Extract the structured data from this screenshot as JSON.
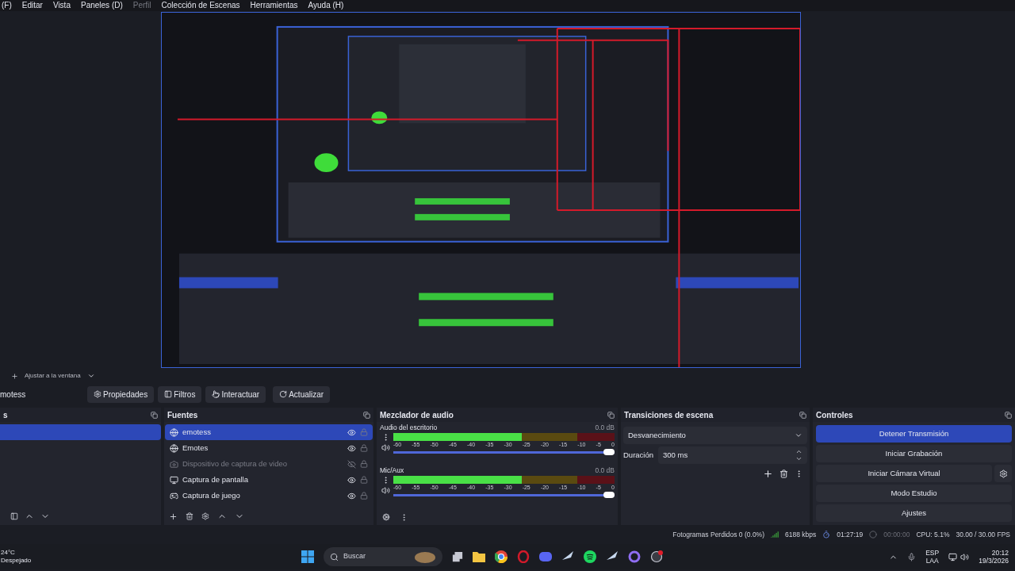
{
  "menu_bar": [
    {
      "label": "(F)",
      "disabled": false
    },
    {
      "label": "Editar",
      "disabled": false
    },
    {
      "label": "Vista",
      "disabled": false
    },
    {
      "label": "Paneles (D)",
      "disabled": false
    },
    {
      "label": "Perfil",
      "disabled": true
    },
    {
      "label": "Colección de Escenas",
      "disabled": false
    },
    {
      "label": "Herramientas",
      "disabled": false
    },
    {
      "label": "Ayuda (H)",
      "disabled": false
    }
  ],
  "preview_toolbar": {
    "zoom_mode": "Ajustar a la ventana"
  },
  "source_toolbar": {
    "current_source": "motess",
    "buttons": [
      {
        "label": "Propiedades"
      },
      {
        "label": "Filtros"
      },
      {
        "label": "Interactuar"
      },
      {
        "label": "Actualizar"
      }
    ]
  },
  "scenes": {
    "title": "s",
    "items": [
      {
        "selected": true
      }
    ]
  },
  "sources": {
    "title": "Fuentes",
    "items": [
      {
        "name": "emotess",
        "kind": "browser",
        "visible": true,
        "disabled": false,
        "selected": true
      },
      {
        "name": "Emotes",
        "kind": "browser",
        "visible": true,
        "disabled": false,
        "selected": false
      },
      {
        "name": "Dispositivo de captura de video",
        "kind": "camera",
        "visible": false,
        "disabled": true,
        "selected": false
      },
      {
        "name": "Captura de pantalla",
        "kind": "display",
        "visible": true,
        "disabled": false,
        "selected": false
      },
      {
        "name": "Captura de juego",
        "kind": "game",
        "visible": true,
        "disabled": false,
        "selected": false
      }
    ]
  },
  "audio_mixer": {
    "title": "Mezclador de audio",
    "channels": [
      {
        "name": "Audio del escritorio",
        "reading": "0.0 dB",
        "meter": {
          "level": 0.58
        },
        "volume": {
          "level": 1
        },
        "scale": [
          "-60",
          "-55",
          "-50",
          "-45",
          "-40",
          "-35",
          "-30",
          "-25",
          "-20",
          "-15",
          "-10",
          "-5",
          "0"
        ]
      },
      {
        "name": "Mic/Aux",
        "reading": "0.0 dB",
        "meter": {
          "level": 0.58
        },
        "volume": {
          "level": 1
        },
        "scale": [
          "-60",
          "-55",
          "-50",
          "-45",
          "-40",
          "-35",
          "-30",
          "-25",
          "-20",
          "-15",
          "-10",
          "-5",
          "0"
        ]
      }
    ]
  },
  "transitions": {
    "title": "Transiciones de escena",
    "transition": "Desvanecimiento",
    "duration_label": "Duración",
    "duration": "300 ms"
  },
  "controls": {
    "title": "Controles",
    "buttons": [
      {
        "label": "Detener Transmisión",
        "active": true,
        "settings": false
      },
      {
        "label": "Iniciar Grabación",
        "active": false,
        "settings": false
      },
      {
        "label": "Iniciar Cámara Virtual",
        "active": false,
        "settings": true
      },
      {
        "label": "Modo Estudio",
        "active": false,
        "settings": false
      },
      {
        "label": "Ajustes",
        "active": false,
        "settings": false
      }
    ]
  },
  "status_bar": {
    "dropped_frames": "Fotogramas Perdidos 0 (0.0%)",
    "bitrate": "6188 kbps",
    "stream_time": "01:27:19",
    "record_time": "00:00:00",
    "cpu": "CPU: 5.1%",
    "fps": "30.00 / 30.00 FPS"
  },
  "taskbar": {
    "temperature": "24°C",
    "weather": "Despejado",
    "search_placeholder": "Buscar",
    "language": "ESP",
    "layout": "LAA",
    "time": "20:12",
    "date": "19/3/2026"
  }
}
